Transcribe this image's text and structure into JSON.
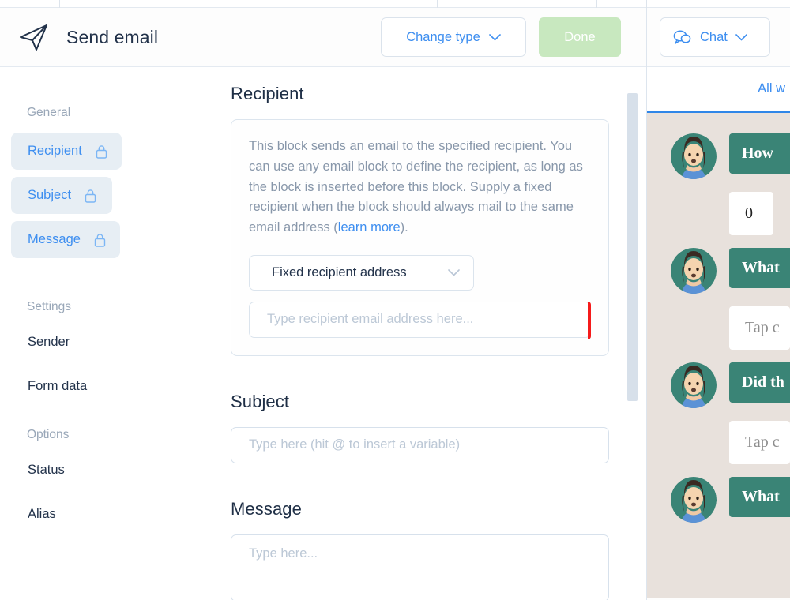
{
  "header": {
    "icon": "paper-plane-icon",
    "title": "Send email",
    "change_type_label": "Change type",
    "done_label": "Done"
  },
  "sidebar": {
    "groups": [
      {
        "title": "General",
        "items": [
          {
            "label": "Recipient",
            "locked": true,
            "active": true
          },
          {
            "label": "Subject",
            "locked": true,
            "active": true
          },
          {
            "label": "Message",
            "locked": true,
            "active": true
          }
        ]
      },
      {
        "title": "Settings",
        "items": [
          {
            "label": "Sender",
            "locked": false,
            "active": false
          },
          {
            "label": "Form data",
            "locked": false,
            "active": false
          }
        ]
      },
      {
        "title": "Options",
        "items": [
          {
            "label": "Status",
            "locked": false,
            "active": false
          },
          {
            "label": "Alias",
            "locked": false,
            "active": false
          }
        ]
      }
    ]
  },
  "main": {
    "recipient": {
      "title": "Recipient",
      "description_part1": "This block sends an email to the specified recipient. You can use any email block to define the recipient, as long as the block is inserted before this block. Supply a fixed recipient when the block should always mail to the same email address (",
      "link_label": "learn more",
      "description_part2": ").",
      "select_value": "Fixed recipient address",
      "input_placeholder": "Type recipient email address here...",
      "input_value": "",
      "has_error": true
    },
    "subject": {
      "title": "Subject",
      "placeholder": "Type here (hit @ to insert a variable)",
      "value": ""
    },
    "message": {
      "title": "Message",
      "placeholder": "Type here...",
      "value": ""
    }
  },
  "chat_panel": {
    "chat_button_label": "Chat",
    "tab_label": "All w",
    "messages": [
      {
        "from": "bot",
        "text": "How"
      },
      {
        "from": "user",
        "text": "0",
        "muted": false
      },
      {
        "from": "bot",
        "text": "What"
      },
      {
        "from": "user",
        "text": "Tap c",
        "muted": true
      },
      {
        "from": "bot",
        "text": "Did th"
      },
      {
        "from": "user",
        "text": "Tap c",
        "muted": true
      },
      {
        "from": "bot",
        "text": "What"
      }
    ]
  },
  "colors": {
    "accent_blue": "#3d8ef0",
    "done_green": "#c8e8bf",
    "error_red": "#f51b1b",
    "bot_bubble_teal": "#3a8476",
    "chat_background": "#e8e1dc",
    "tab_underline": "#2f86e8"
  }
}
